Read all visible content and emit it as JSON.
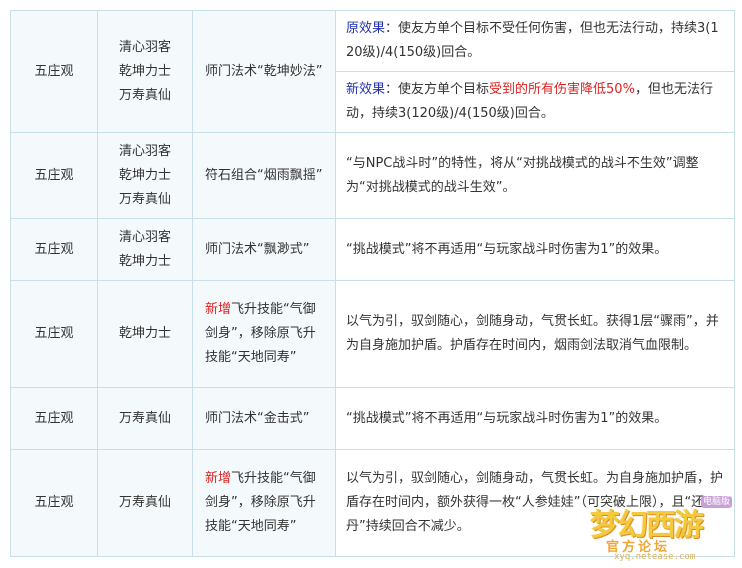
{
  "rows": [
    {
      "school": "五庄观",
      "sects": [
        "清心羽客",
        "乾坤力士",
        "万寿真仙"
      ],
      "skill": "师门法术“乾坤妙法”",
      "orig_label": "原效果",
      "orig_text": "：使友方单个目标不受任何伤害，但也无法行动，持续3(120级)/4(150级)回合。",
      "new_label": "新效果",
      "new_pre": "：使友方单个目标",
      "new_red": "受到的所有伤害降低50%",
      "new_post": "，但也无法行动，持续3(120级)/4(150级)回合。"
    },
    {
      "school": "五庄观",
      "sects": [
        "清心羽客",
        "乾坤力士",
        "万寿真仙"
      ],
      "skill": "符石组合“烟雨飘摇”",
      "effect": "“与NPC战斗时”的特性，将从“对挑战模式的战斗不生效”调整为“对挑战模式的战斗生效”。"
    },
    {
      "school": "五庄观",
      "sects": [
        "清心羽客",
        "乾坤力士"
      ],
      "skill": "师门法术“飘渺式”",
      "effect": "“挑战模式”将不再适用“与玩家战斗时伤害为1”的效果。"
    },
    {
      "school": "五庄观",
      "sects": [
        "乾坤力士"
      ],
      "skill_red": "新增",
      "skill": "飞升技能“气御剑身”，移除原飞升技能“天地同寿”",
      "effect": "以气为引，驭剑随心，剑随身动，气贯长虹。获得1层“骤雨”，并为自身施加护盾。护盾存在时间内，烟雨剑法取消气血限制。"
    },
    {
      "school": "五庄观",
      "sects": [
        "万寿真仙"
      ],
      "skill": "师门法术“金击式”",
      "effect": "“挑战模式”将不再适用“与玩家战斗时伤害为1”的效果。"
    },
    {
      "school": "五庄观",
      "sects": [
        "万寿真仙"
      ],
      "skill_red": "新增",
      "skill": "飞升技能“气御剑身”，移除原飞升技能“天地同寿”",
      "effect": "以气为引，驭剑随心，剑随身动，气贯长虹。为自身施加护盾，护盾存在时间内，额外获得一枚“人参娃娃”（可突破上限），且“还丹”持续回合不减少。"
    }
  ],
  "watermark": {
    "title": "梦幻西游",
    "badge": "电脑版",
    "subtitle": "官方论坛",
    "url": "xyq.netease.com"
  },
  "colors": {
    "border": "#c9dfe8",
    "cell_bg": "#f4fafc",
    "red": "#e02020",
    "blue": "#2233aa"
  }
}
